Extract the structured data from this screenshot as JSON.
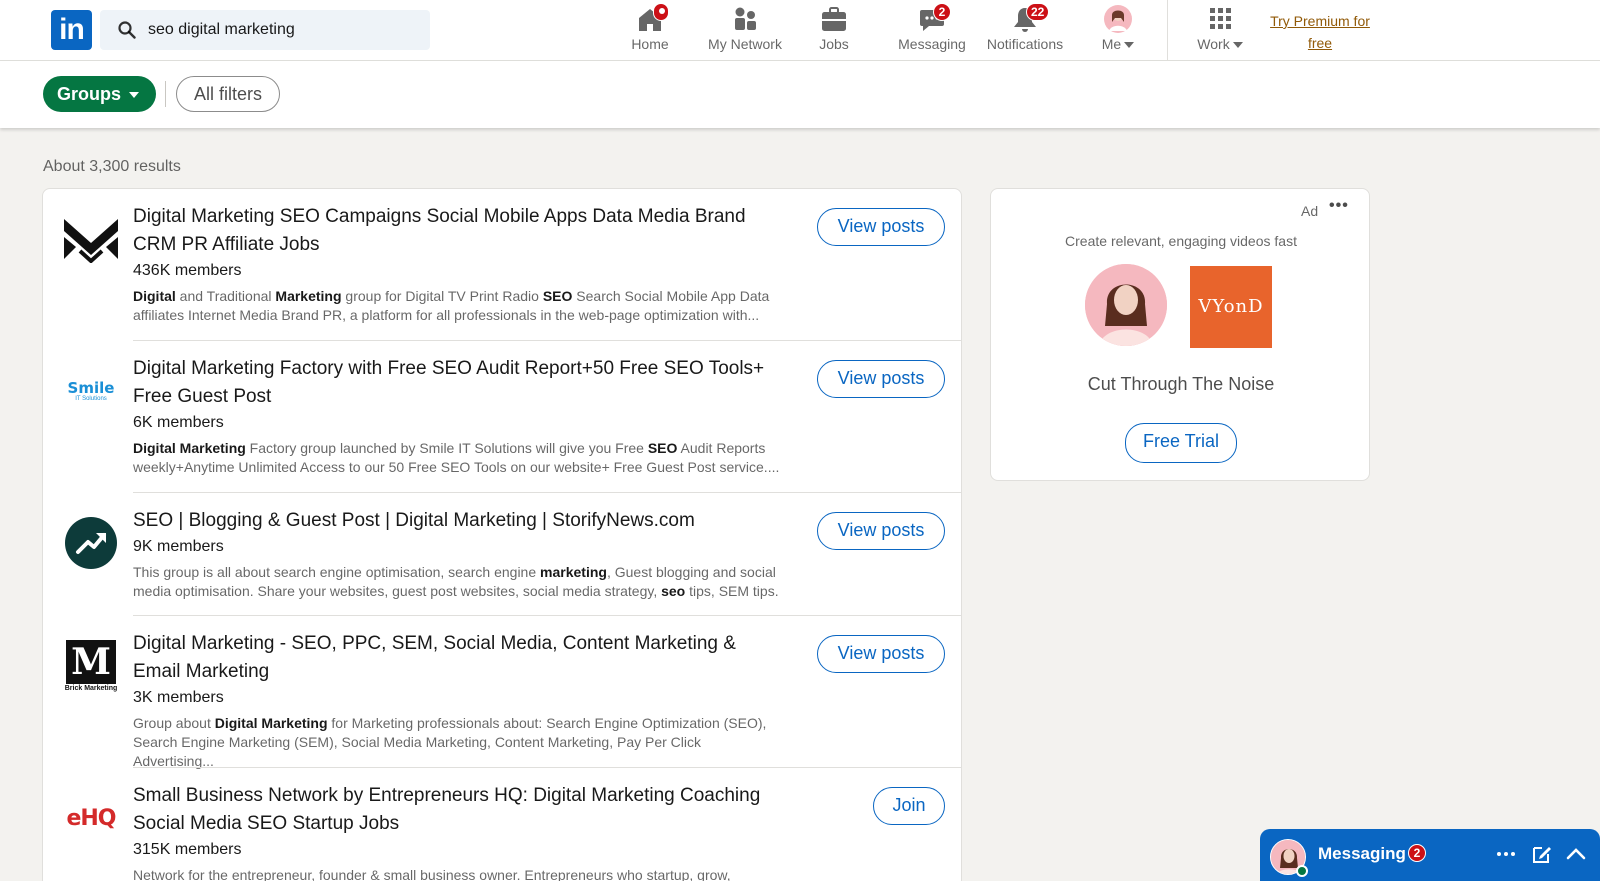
{
  "header": {
    "logo_text": "in",
    "search": {
      "value": "seo digital marketing",
      "placeholder": "Search"
    },
    "nav": [
      {
        "label": "Home",
        "icon": "home-icon",
        "badge": ""
      },
      {
        "label": "My Network",
        "icon": "network-icon",
        "badge": ""
      },
      {
        "label": "Jobs",
        "icon": "briefcase-icon",
        "badge": ""
      },
      {
        "label": "Messaging",
        "icon": "messaging-icon",
        "badge": "2"
      },
      {
        "label": "Notifications",
        "icon": "bell-icon",
        "badge": "22"
      },
      {
        "label": "Me",
        "icon": "avatar",
        "badge": ""
      },
      {
        "label": "Work",
        "icon": "grid-icon",
        "badge": ""
      }
    ],
    "premium_line1": "Try Premium for",
    "premium_line2": "free"
  },
  "filters": {
    "groups_label": "Groups",
    "all_filters_label": "All filters"
  },
  "results_count": "About 3,300 results",
  "results": [
    {
      "title": "Digital Marketing SEO Campaigns Social Mobile Apps Data Media Brand CRM PR Affiliate Jobs",
      "members": "436K members",
      "desc_html": "<b>Digital</b> and Traditional <b>Marketing</b> group for Digital TV Print Radio <b>SEO</b> Search Social Mobile App Data affiliates Internet Media Brand PR, a platform for all professionals in the web-page optimization with...",
      "action": "View posts"
    },
    {
      "title": "Digital Marketing Factory with Free SEO Audit Report+50 Free SEO Tools+ Free Guest Post",
      "members": "6K members",
      "desc_html": "<b>Digital Marketing</b> Factory group launched by Smile IT Solutions will give you Free <b>SEO</b> Audit Reports weekly+Anytime Unlimited Access to our 50 Free SEO Tools on our website+ Free Guest Post service....",
      "action": "View posts"
    },
    {
      "title": "SEO | Blogging & Guest Post | Digital Marketing | StorifyNews.com",
      "members": "9K members",
      "desc_html": "This group is all about search engine optimisation, search engine <b>marketing</b>, Guest blogging and social media optimisation. Share your websites, guest post websites, social media strategy, <b>seo</b> tips, SEM tips.",
      "action": "View posts"
    },
    {
      "title": "Digital Marketing - SEO, PPC, SEM, Social Media, Content Marketing & Email Marketing",
      "members": "3K members",
      "desc_html": "Group about <b>Digital Marketing</b> for Marketing professionals about: Search Engine Optimization (SEO), Search Engine Marketing (SEM), Social Media Marketing, Content Marketing, Pay Per Click Advertising...",
      "action": "View posts"
    },
    {
      "title": "Small Business Network by Entrepreneurs HQ: Digital Marketing Coaching Social Media SEO Startup Jobs",
      "members": "315K members",
      "desc_html": "Network for the entrepreneur, founder & small business owner. Entrepreneurs who startup, grow, manage an SMB",
      "action": "Join"
    }
  ],
  "logos": {
    "smile_main": "Smile",
    "smile_sub": "IT Solutions",
    "brick_letter": "M",
    "brick_sub": "Brick Marketing",
    "ehq": "eHQ"
  },
  "ad": {
    "label": "Ad",
    "more": "•••",
    "tagline": "Create relevant, engaging videos fast",
    "brand_logo": "VYonD",
    "headline": "Cut Through The Noise",
    "cta": "Free Trial"
  },
  "messaging": {
    "label": "Messaging",
    "badge": "2"
  },
  "colors": {
    "brand_blue": "#0a66c2",
    "groups_green": "#057642",
    "badge_red": "#cc1016",
    "premium_gold": "#915907"
  }
}
